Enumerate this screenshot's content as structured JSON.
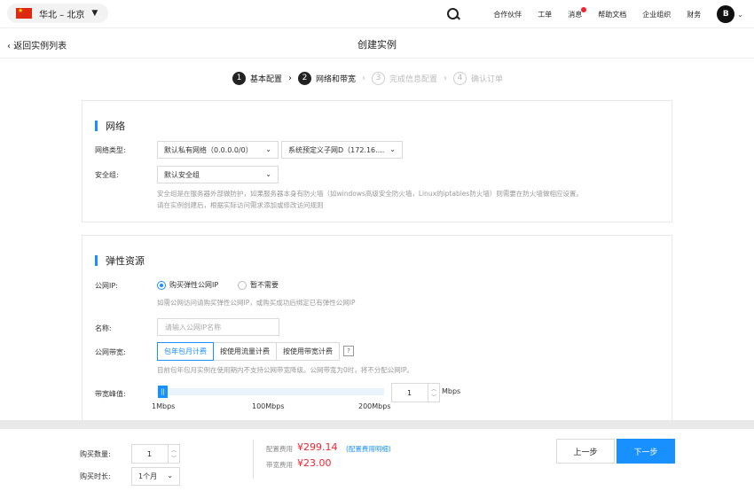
{
  "topbar": {
    "region": "华北 – 北京",
    "nav": [
      "合作伙伴",
      "工单",
      "消息",
      "帮助文档",
      "企业组织",
      "财务"
    ],
    "avatar": "B"
  },
  "header": {
    "back": "返回实例列表",
    "title": "创建实例"
  },
  "steps": [
    {
      "num": "1",
      "label": "基本配置"
    },
    {
      "num": "2",
      "label": "网络和带宽"
    },
    {
      "num": "3",
      "label": "完成信息配置"
    },
    {
      "num": "4",
      "label": "确认订单"
    }
  ],
  "network": {
    "title": "网络",
    "type_label": "网络类型:",
    "vpc_value": "默认私有网络（0.0.0.0/0）",
    "subnet_value": "系统预定义子网D（172.16....",
    "sg_label": "安全组:",
    "sg_value": "默认安全组",
    "help_1": "安全组是在服务器外部做防护，如果服务器本身有防火墙（如windows高级安全防火墙，Linux的iptables防火墙）则需要在防火墙做相应设置。",
    "help_2": "请在实例创建后，根据实际访问需求添加或修改访问规则"
  },
  "elastic": {
    "title": "弹性资源",
    "ip_label": "公网IP:",
    "ip_opt_buy": "购买弹性公网IP",
    "ip_opt_none": "暂不需要",
    "ip_help": "如需公网访问请购买弹性公网IP，或购买成功后绑定已有弹性公网IP",
    "name_label": "名称:",
    "name_placeholder": "请输入公网IP名称",
    "bw_label": "公网带宽:",
    "bw_opts": [
      "包年包月计费",
      "按使用流量计费",
      "按使用带宽计费"
    ],
    "bw_help_icon": "?",
    "bw_help": "目前包年包月实例在使用期内不支持公网带宽降级。公网带宽为0时，将不分配公网IP。",
    "peak_label": "带宽峰值:",
    "handle": "||",
    "ticks": [
      "1Mbps",
      "100Mbps",
      "200Mbps"
    ],
    "peak_value": "1",
    "peak_unit": "Mbps"
  },
  "footer": {
    "qty_label": "购买数量:",
    "qty_value": "1",
    "dur_label": "购买时长:",
    "dur_value": "1个月",
    "config_fee_label": "配置费用",
    "config_fee": "¥299.14",
    "config_fee_link": "(配置费用明细)",
    "bw_fee_label": "带宽费用",
    "bw_fee": "¥23.00",
    "prev": "上一步",
    "next": "下一步"
  },
  "colors": {
    "accent": "#1890ff",
    "price": "#f5222d"
  }
}
